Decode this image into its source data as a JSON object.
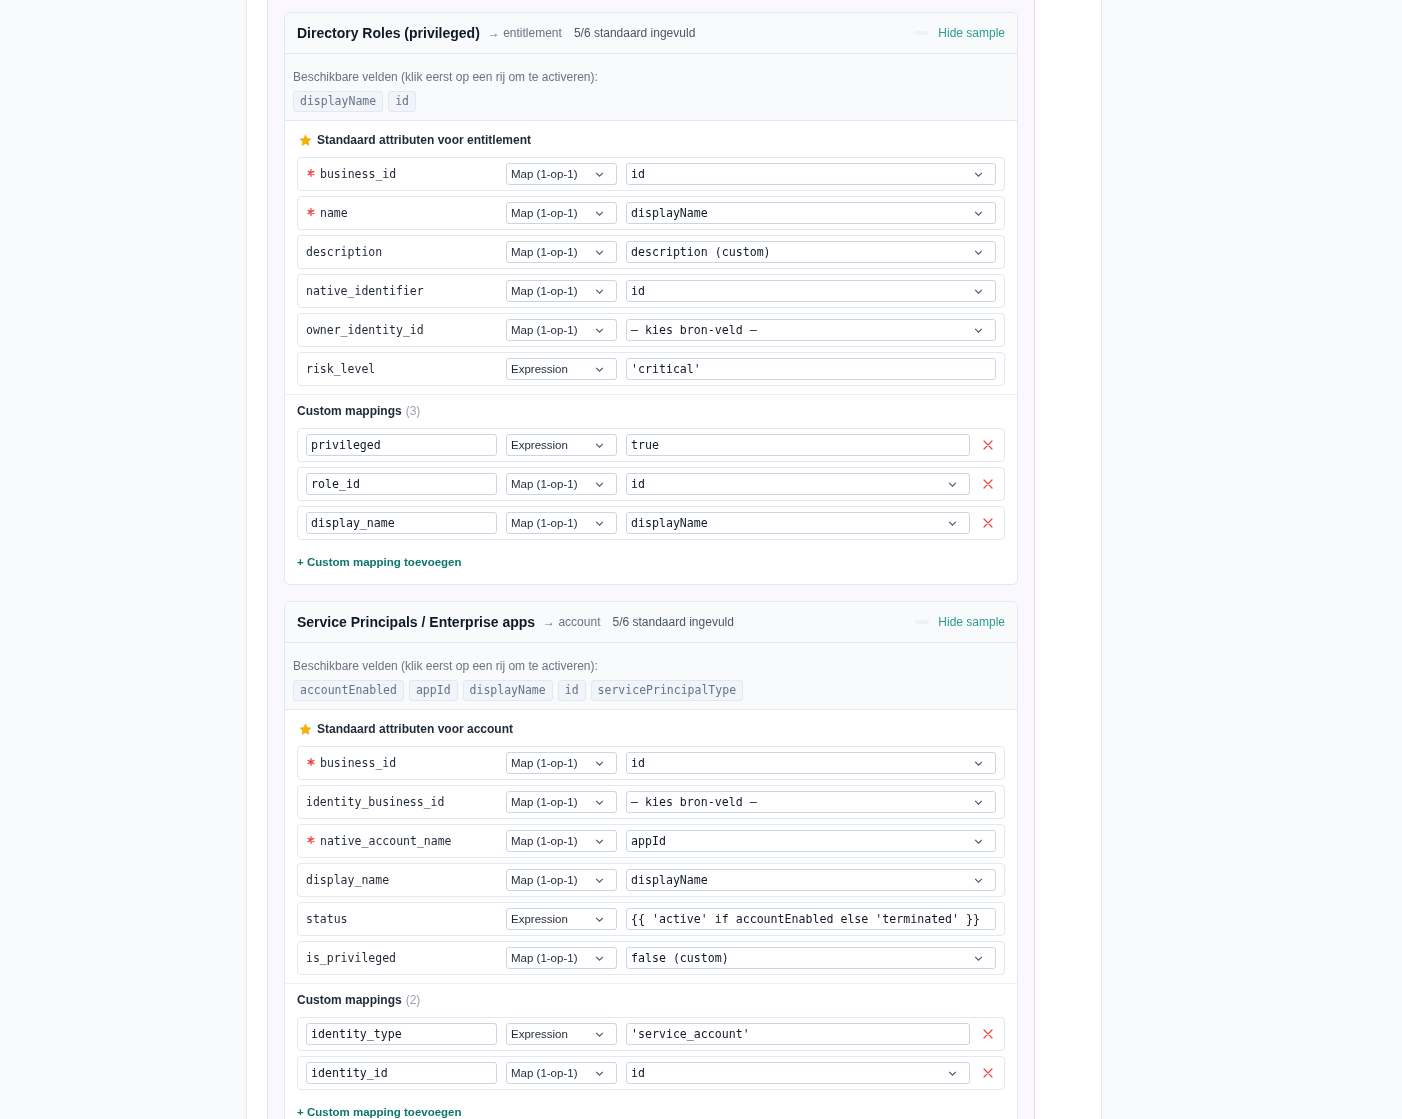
{
  "sections": [
    {
      "title": "Directory Roles (privileged)",
      "target": "→ entitlement",
      "filled": "5/6 standaard ingevuld",
      "sample_toggle": "Hide sample",
      "sample_hint": "Beschikbare velden (klik eerst op een rij om te activeren):",
      "sample_fields": [
        "displayName",
        "id"
      ],
      "standard_heading": "Standaard attributen voor entitlement",
      "standard_rows": [
        {
          "attribute": "business_id",
          "required": true,
          "kind": "map",
          "mode": "Map (1-op-1)",
          "source": "id"
        },
        {
          "attribute": "name",
          "required": true,
          "kind": "map",
          "mode": "Map (1-op-1)",
          "source": "displayName"
        },
        {
          "attribute": "description",
          "required": false,
          "kind": "map",
          "mode": "Map (1-op-1)",
          "source": "description (custom)"
        },
        {
          "attribute": "native_identifier",
          "required": false,
          "kind": "map",
          "mode": "Map (1-op-1)",
          "source": "id"
        },
        {
          "attribute": "owner_identity_id",
          "required": false,
          "kind": "map",
          "mode": "Map (1-op-1)",
          "source": "— kies bron-veld —"
        },
        {
          "attribute": "risk_level",
          "required": false,
          "kind": "expression",
          "mode": "Expression",
          "source": "'critical'"
        }
      ],
      "custom_heading": "Custom mappings",
      "custom_count": "(3)",
      "custom_rows": [
        {
          "name": "privileged",
          "kind": "expression",
          "mode": "Expression",
          "source": "true"
        },
        {
          "name": "role_id",
          "kind": "map",
          "mode": "Map (1-op-1)",
          "source": "id"
        },
        {
          "name": "display_name",
          "kind": "map",
          "mode": "Map (1-op-1)",
          "source": "displayName"
        }
      ],
      "add_link": "+ Custom mapping toevoegen"
    },
    {
      "title": "Service Principals / Enterprise apps",
      "target": "→ account",
      "filled": "5/6 standaard ingevuld",
      "sample_toggle": "Hide sample",
      "sample_hint": "Beschikbare velden (klik eerst op een rij om te activeren):",
      "sample_fields": [
        "accountEnabled",
        "appId",
        "displayName",
        "id",
        "servicePrincipalType"
      ],
      "standard_heading": "Standaard attributen voor account",
      "standard_rows": [
        {
          "attribute": "business_id",
          "required": true,
          "kind": "map",
          "mode": "Map (1-op-1)",
          "source": "id"
        },
        {
          "attribute": "identity_business_id",
          "required": false,
          "kind": "map",
          "mode": "Map (1-op-1)",
          "source": "— kies bron-veld —"
        },
        {
          "attribute": "native_account_name",
          "required": true,
          "kind": "map",
          "mode": "Map (1-op-1)",
          "source": "appId"
        },
        {
          "attribute": "display_name",
          "required": false,
          "kind": "map",
          "mode": "Map (1-op-1)",
          "source": "displayName"
        },
        {
          "attribute": "status",
          "required": false,
          "kind": "expression",
          "mode": "Expression",
          "source": "{{ 'active' if accountEnabled else 'terminated' }}"
        },
        {
          "attribute": "is_privileged",
          "required": false,
          "kind": "map",
          "mode": "Map (1-op-1)",
          "source": "false (custom)"
        }
      ],
      "custom_heading": "Custom mappings",
      "custom_count": "(2)",
      "custom_rows": [
        {
          "name": "identity_type",
          "kind": "expression",
          "mode": "Expression",
          "source": "'service_account'"
        },
        {
          "name": "identity_id",
          "kind": "map",
          "mode": "Map (1-op-1)",
          "source": "id"
        }
      ],
      "add_link": "+ Custom mapping toevoegen"
    }
  ]
}
